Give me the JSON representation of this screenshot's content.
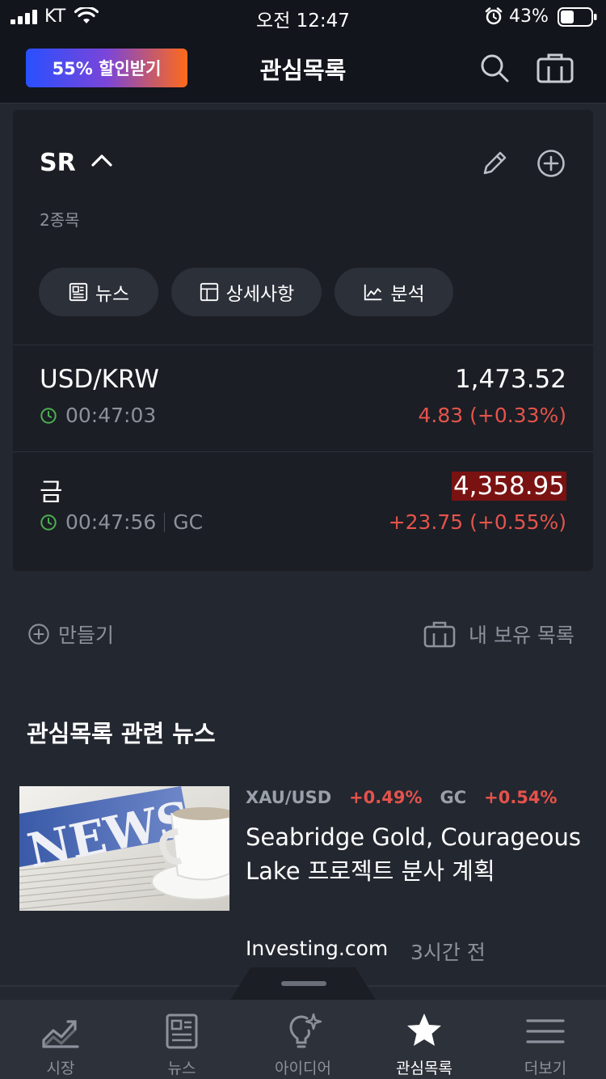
{
  "status_bar": {
    "carrier": "KT",
    "time": "오전 12:47",
    "battery": "43%"
  },
  "header": {
    "promo_label": "55% 할인받기",
    "title": "관심목록"
  },
  "watchlist": {
    "name": "SR",
    "count": "2종목",
    "chips": {
      "news": "뉴스",
      "details": "상세사항",
      "analysis": "분석"
    },
    "rows": [
      {
        "name": "USD/KRW",
        "time": "00:47:03",
        "exchange": "",
        "price": "1,473.52",
        "change": "4.83 (+0.33%)"
      },
      {
        "name": "금",
        "time": "00:47:56",
        "exchange": "GC",
        "price": "4,358.95",
        "change": "+23.75 (+0.55%)"
      }
    ]
  },
  "actions": {
    "create": "만들기",
    "holdings": "내 보유 목록"
  },
  "news_section": {
    "title": "관심목록 관련 뉴스",
    "item": {
      "thumb_text": "NEWS",
      "tickers": [
        {
          "symbol": "XAU/USD",
          "change": "+0.49%"
        },
        {
          "symbol": "GC",
          "change": "+0.54%"
        }
      ],
      "headline": "Seabridge Gold, Courageous Lake 프로젝트 분사 계획",
      "source": "Investing.com",
      "age": "3시간 전"
    }
  },
  "tab_bar": {
    "items": [
      {
        "label": "시장",
        "icon": "market-chart-icon"
      },
      {
        "label": "뉴스",
        "icon": "newspaper-icon"
      },
      {
        "label": "아이디어",
        "icon": "lightbulb-icon"
      },
      {
        "label": "관심목록",
        "icon": "star-icon"
      },
      {
        "label": "더보기",
        "icon": "menu-icon"
      }
    ],
    "active": "관심목록"
  },
  "colors": {
    "background": "#232730",
    "card": "#1b1e25",
    "negative_red": "#e5534b",
    "clock_green": "#4caf50",
    "price_highlight": "#7a1212"
  }
}
